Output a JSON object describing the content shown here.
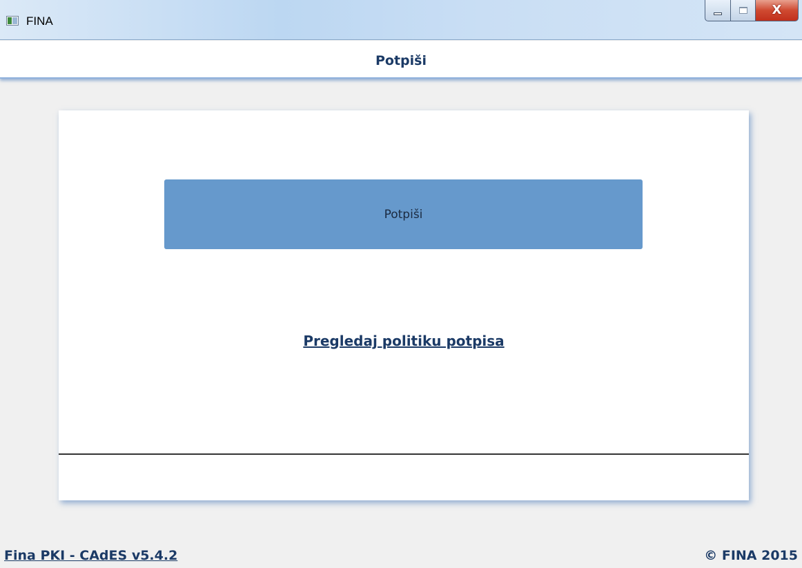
{
  "window": {
    "title": "FINA",
    "icon": "app-window-icon",
    "controls": {
      "minimize_icon": "minimize-icon",
      "maximize_icon": "maximize-icon",
      "close_icon": "close-icon",
      "close_glyph": "X"
    }
  },
  "header": {
    "title": "Potpiši"
  },
  "card": {
    "sign_button_label": "Potpiši",
    "policy_link": "Pregledaj politiku potpisa"
  },
  "footer": {
    "version_link": "Fina PKI - CAdES v5.4.2",
    "copyright": "© FINA 2015"
  },
  "colors": {
    "accent": "#6699cc",
    "text_dark_blue": "#1b3a66",
    "close_button": "#c9402a"
  }
}
